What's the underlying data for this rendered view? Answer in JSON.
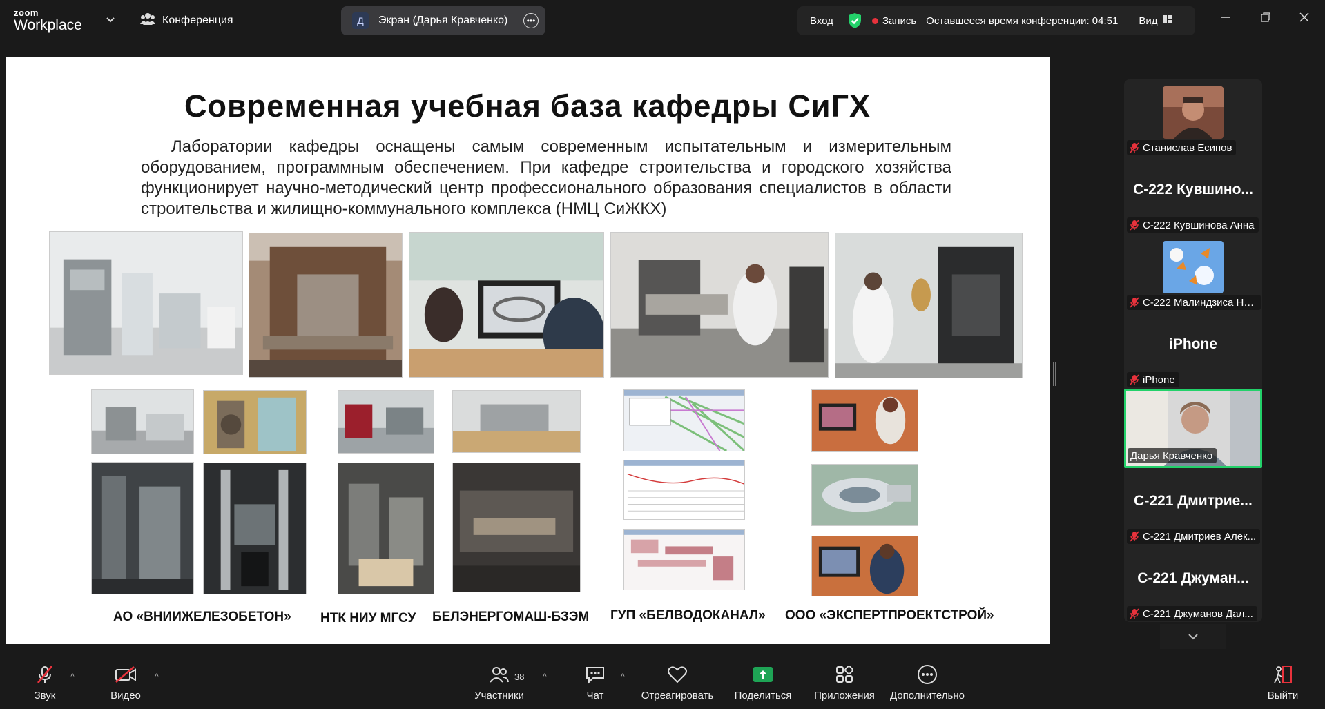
{
  "app": {
    "logo_top": "zoom",
    "logo_bottom": "Workplace",
    "conference_label": "Конференция"
  },
  "share": {
    "avatar_letter": "Д",
    "title": "Экран (Дарья Кравченко)"
  },
  "status": {
    "login": "Вход",
    "record": "Запись",
    "remaining": "Оставшееся время конференции: 04:51",
    "view": "Вид"
  },
  "slide": {
    "title": "Современная учебная база кафедры СиГХ",
    "paragraph": "Лаборатории кафедры оснащены самым современным испытательным и измерительным оборудованием, программным обеспечением. При кафедре строительства и городского хозяйства функционирует научно-методический центр профессионального образования специалистов в области строительства и жилищно-коммунального комплекса (НМЦ СиЖКХ)",
    "captions": [
      "АО «ВНИИЖЕЛЕЗОБЕТОН»",
      "НТК НИУ МГСУ",
      "БЕЛЭНЕРГОМАШ-БЗЭМ",
      "ГУП «БЕЛВОДОКАНАЛ»",
      "ООО «ЭКСПЕРТПРОЕКТСТРОЙ»"
    ]
  },
  "participants": [
    {
      "big": "",
      "label": "Станислав Есипов",
      "thumb": "photo"
    },
    {
      "big": "С-222  Кувшино...",
      "label": "С-222 Кувшинова Анна",
      "thumb": ""
    },
    {
      "big": "",
      "label": "С-222 Малиндзиса Но...",
      "thumb": "butterflies"
    },
    {
      "big": "iPhone",
      "label": "iPhone",
      "thumb": ""
    },
    {
      "big": "",
      "label": "Дарья Кравченко",
      "thumb": "video"
    },
    {
      "big": "С-221  Дмитрие...",
      "label": "С-221 Дмитриев Алек...",
      "thumb": ""
    },
    {
      "big": "С-221  Джуман...",
      "label": "С-221 Джуманов Дал...",
      "thumb": ""
    }
  ],
  "toolbar": {
    "audio": "Звук",
    "video": "Видео",
    "participants": "Участники",
    "participants_count": "38",
    "chat": "Чат",
    "react": "Отреагировать",
    "share": "Поделиться",
    "apps": "Приложения",
    "more": "Дополнительно",
    "leave": "Выйти"
  },
  "colors": {
    "accent_green": "#23d16a",
    "share_green": "#1ea455",
    "record_red": "#e8323c",
    "leave_red": "#e8323c"
  }
}
